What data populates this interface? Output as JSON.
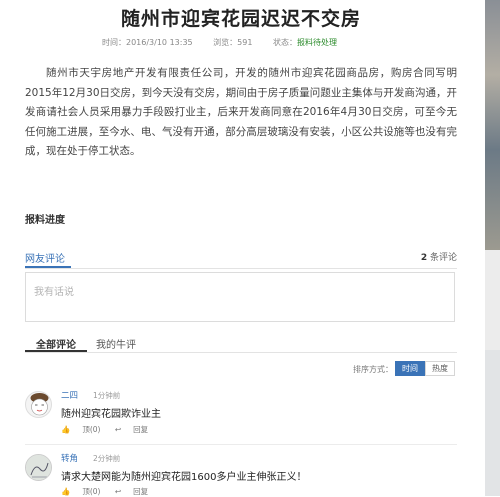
{
  "article": {
    "title": "随州市迎宾花园迟迟不交房",
    "meta": {
      "time_label": "时间：",
      "time": "2016/3/10 13:35",
      "views_label": "浏览：",
      "views": "591",
      "status_label": "状态：",
      "status": "报料待处理"
    },
    "body": "随州市天宇房地产开发有限责任公司，开发的随州市迎宾花园商品房，购房合同写明2015年12月30日交房，到今天没有交房，期间由于房子质量问题业主集体与开发商沟通，开发商请社会人员采用暴力手段殴打业主，后来开发商同意在2016年4月30日交房，可至今无任何施工进展，至今水、电、气没有开通，部分高层玻璃没有安装，小区公共设施等也没有完成，现在处于停工状态。",
    "progress_label": "报料进度"
  },
  "comments": {
    "section_title": "网友评论",
    "count": "2",
    "count_suffix": "条评论",
    "input_placeholder": "我有话说",
    "tabs": [
      "全部评论",
      "我的牛评"
    ],
    "sort_label": "排序方式：",
    "sort_options": [
      "时间",
      "热度"
    ],
    "items": [
      {
        "name": "二四",
        "time": "1分钟前",
        "text": "随州迎宾花园欺诈业主",
        "like": "顶(0)",
        "reply": "回复"
      },
      {
        "name": "转角",
        "time": "2分钟前",
        "text": "请求大楚网能为随州迎宾花园1600多户业主伸张正义！",
        "like": "顶(0)",
        "reply": "回复"
      }
    ]
  },
  "colors": {
    "accent": "#3a73b7",
    "status": "#2a8a2a"
  }
}
